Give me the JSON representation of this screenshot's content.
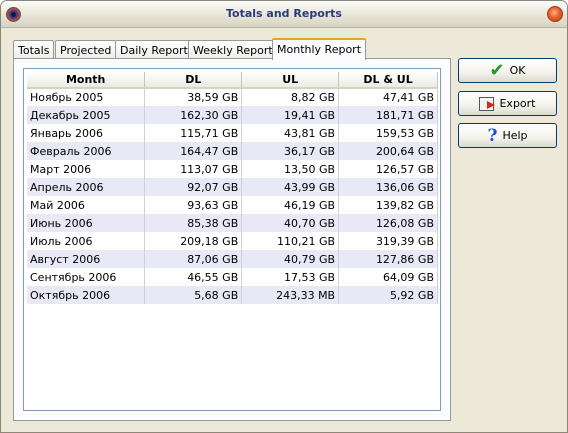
{
  "window": {
    "title": "Totals and Reports"
  },
  "tabs": [
    {
      "label": "Totals"
    },
    {
      "label": "Projected"
    },
    {
      "label": "Daily Report"
    },
    {
      "label": "Weekly Report"
    },
    {
      "label": "Monthly Report"
    }
  ],
  "active_tab": "Monthly Report",
  "table": {
    "columns": [
      "Month",
      "DL",
      "UL",
      "DL & UL"
    ],
    "rows": [
      [
        "Ноябрь 2005",
        "38,59 GB",
        "8,82 GB",
        "47,41 GB"
      ],
      [
        "Декабрь 2005",
        "162,30 GB",
        "19,41 GB",
        "181,71 GB"
      ],
      [
        "Январь 2006",
        "115,71 GB",
        "43,81 GB",
        "159,53 GB"
      ],
      [
        "Февраль 2006",
        "164,47 GB",
        "36,17 GB",
        "200,64 GB"
      ],
      [
        "Март 2006",
        "113,07 GB",
        "13,50 GB",
        "126,57 GB"
      ],
      [
        "Апрель 2006",
        "92,07 GB",
        "43,99 GB",
        "136,06 GB"
      ],
      [
        "Май 2006",
        "93,63 GB",
        "46,19 GB",
        "139,82 GB"
      ],
      [
        "Июнь 2006",
        "85,38 GB",
        "40,70 GB",
        "126,08 GB"
      ],
      [
        "Июль 2006",
        "209,18 GB",
        "110,21 GB",
        "319,39 GB"
      ],
      [
        "Август 2006",
        "87,06 GB",
        "40,79 GB",
        "127,86 GB"
      ],
      [
        "Сентябрь 2006",
        "46,55 GB",
        "17,53 GB",
        "64,09 GB"
      ],
      [
        "Октябрь 2006",
        "5,68 GB",
        "243,33 MB",
        "5,92 GB"
      ]
    ]
  },
  "buttons": {
    "ok": {
      "label": "OK",
      "icon": "checkmark-icon"
    },
    "export": {
      "label": "Export",
      "icon": "export-icon"
    },
    "help": {
      "label": "Help",
      "icon": "help-icon"
    }
  },
  "colors": {
    "title_text": "#2b3a7a",
    "row_alt": "#e8e8f6",
    "active_tab_accent": "#e1a81f"
  }
}
